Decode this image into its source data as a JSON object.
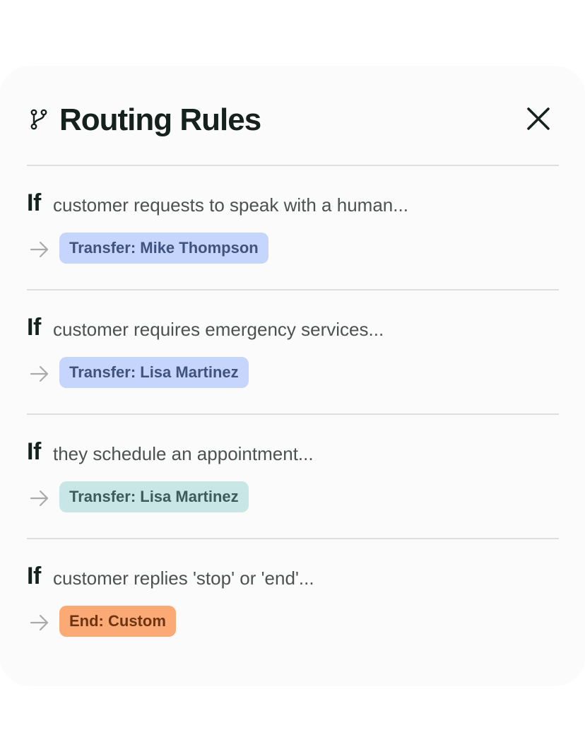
{
  "header": {
    "icon": "branch-icon",
    "title": "Routing Rules",
    "close_icon": "close-icon"
  },
  "rules": [
    {
      "keyword": "If",
      "condition": "customer requests to speak with a human...",
      "action": "Transfer: Mike Thompson",
      "action_bg": "#c5d5fb",
      "action_color": "#41527e"
    },
    {
      "keyword": "If",
      "condition": "customer requires emergency services...",
      "action": "Transfer: Lisa Martinez",
      "action_bg": "#c5d5fb",
      "action_color": "#41527e"
    },
    {
      "keyword": "If",
      "condition": "they schedule an appointment...",
      "action": "Transfer: Lisa Martinez",
      "action_bg": "#c8e6e5",
      "action_color": "#3c5c5b"
    },
    {
      "keyword": "If",
      "condition": "customer replies 'stop' or 'end'...",
      "action": "End: Custom",
      "action_bg": "#fcaa75",
      "action_color": "#6b3412"
    }
  ],
  "colors": {
    "panel_bg": "#fbfbfb",
    "text_dark": "#14211c",
    "text_muted": "#4b524f",
    "divider": "#dedede",
    "arrow": "#a7aaa8"
  }
}
